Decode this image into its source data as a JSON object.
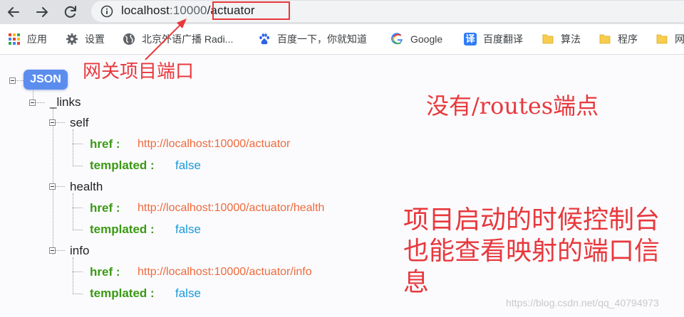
{
  "browser": {
    "url_host": "localhost",
    "url_port": ":10000",
    "url_path": "/actuator"
  },
  "bookmarks": [
    {
      "label": "应用",
      "icon": "apps-grid-icon"
    },
    {
      "label": "设置",
      "icon": "gear-icon"
    },
    {
      "label": "北京外语广播 Radi...",
      "icon": "globe-icon"
    },
    {
      "label": "百度一下，你就知道",
      "icon": "baidu-paw-icon"
    },
    {
      "label": "Google",
      "icon": "google-g-icon"
    },
    {
      "label": "百度翻译",
      "icon": "translate-icon"
    },
    {
      "label": "算法",
      "icon": "folder-icon"
    },
    {
      "label": "程序",
      "icon": "folder-icon"
    },
    {
      "label": "网",
      "icon": "folder-icon"
    }
  ],
  "json_view": {
    "root_badge": "JSON",
    "links_key": "_links",
    "groups": [
      {
        "name": "self",
        "href_key": "href :",
        "href_value": "http://localhost:10000/actuator",
        "templated_key": "templated :",
        "templated_value": "false"
      },
      {
        "name": "health",
        "href_key": "href :",
        "href_value": "http://localhost:10000/actuator/health",
        "templated_key": "templated :",
        "templated_value": "false"
      },
      {
        "name": "info",
        "href_key": "href :",
        "href_value": "http://localhost:10000/actuator/info",
        "templated_key": "templated :",
        "templated_value": "false"
      }
    ]
  },
  "annotations": {
    "gateway_port": "网关项目端口",
    "no_routes": "没有/routes端点",
    "console_line1": "项目启动的时候控制台",
    "console_line2": "也能查看映射的端口信",
    "console_line3": "息",
    "color": "#e8383c"
  },
  "watermark": "https://blog.csdn.net/qq_40794973"
}
